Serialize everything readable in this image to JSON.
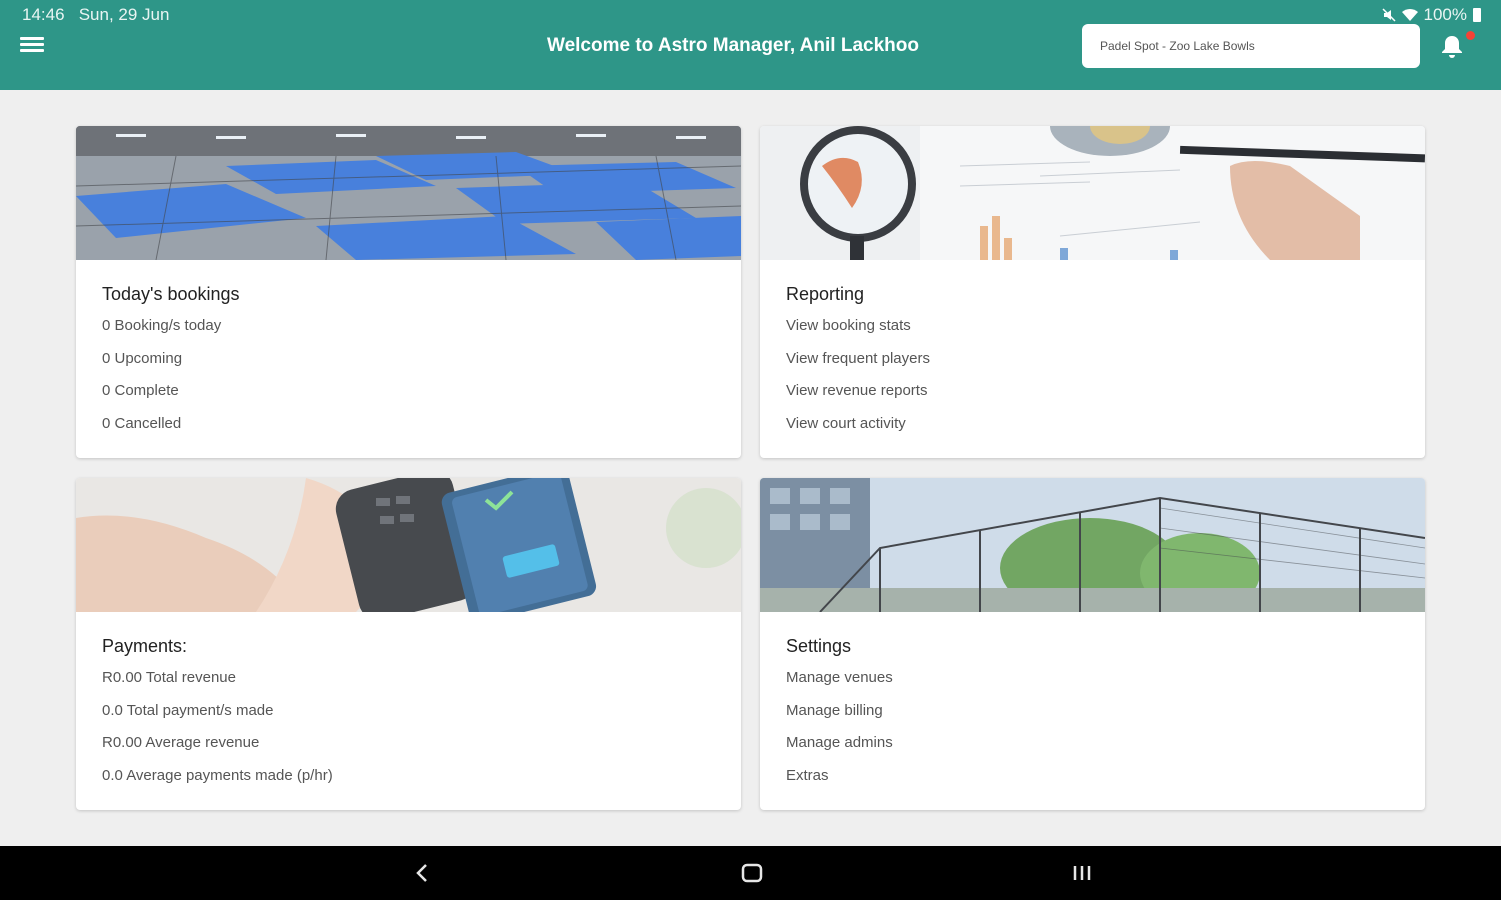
{
  "status": {
    "time": "14:46",
    "date": "Sun, 29 Jun",
    "battery": "100%",
    "icons": [
      "mute-icon",
      "wifi-icon",
      "battery-icon"
    ]
  },
  "header": {
    "title": "Welcome to Astro Manager, Anil Lackhoo",
    "venue": "Padel Spot - Zoo Lake Bowls",
    "color": "#2e9688"
  },
  "cards": [
    {
      "title": "Today's bookings",
      "lines": [
        "0 Booking/s today",
        "0 Upcoming",
        "0 Complete",
        "0 Cancelled"
      ]
    },
    {
      "title": "Reporting",
      "lines": [
        "View booking stats",
        "View frequent players",
        "View revenue reports",
        "View court activity"
      ]
    },
    {
      "title": "Payments:",
      "lines": [
        "R0.00 Total revenue",
        "0.0 Total payment/s made",
        "R0.00 Average revenue",
        "0.0 Average payments made (p/hr)"
      ]
    },
    {
      "title": "Settings",
      "lines": [
        "Manage venues",
        "Manage billing",
        "Manage admins",
        "Extras"
      ]
    }
  ],
  "nav": [
    "back-icon",
    "home-icon",
    "recents-icon"
  ]
}
